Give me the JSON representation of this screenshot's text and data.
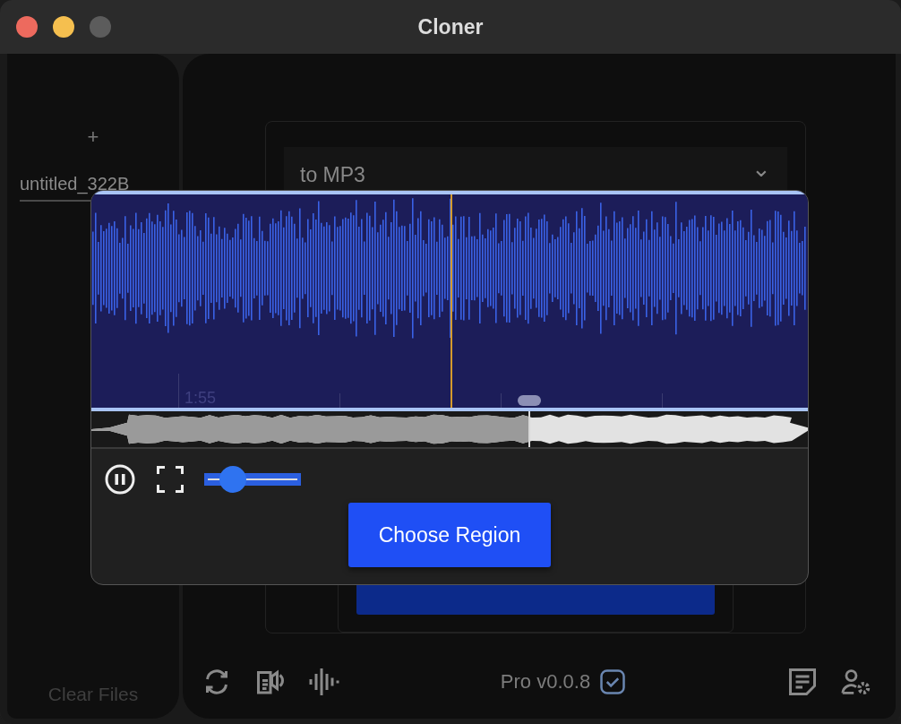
{
  "window": {
    "title": "Cloner"
  },
  "sidebar": {
    "add_button": "+",
    "file": "untitled_322B",
    "clear_button": "Clear Files"
  },
  "main": {
    "format_select": {
      "value": "to MP3",
      "caret": "⌄"
    }
  },
  "region_dialog": {
    "time_label": "1:55",
    "overview": {
      "level": 0.61
    },
    "zoom_slider": {
      "level": 0.3
    },
    "playing": true,
    "choose_button": "Choose Region"
  },
  "status_bar": {
    "version": "Pro v0.0.8",
    "verified": true
  }
}
